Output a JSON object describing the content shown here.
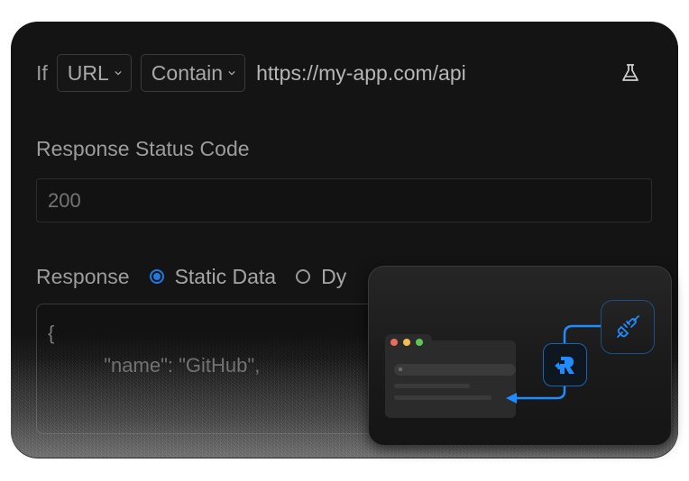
{
  "condition": {
    "if_label": "If",
    "field_select": "URL",
    "operator_select": "Contain",
    "url_value": "https://my-app.com/api",
    "test_icon": "flask-icon"
  },
  "status": {
    "label": "Response Status Code",
    "placeholder": "200"
  },
  "response": {
    "label": "Response",
    "options": [
      {
        "label": "Static Data",
        "checked": true
      },
      {
        "label": "Dy",
        "checked": false
      }
    ],
    "code_lines": [
      "{",
      "  \"name\": \"GitHub\","
    ]
  },
  "overlay_card": {
    "window_dots": [
      "#ec6a5e",
      "#f4bf4f",
      "#61c554"
    ],
    "logo_letter": "R",
    "plug_icon": "plug-icon",
    "accent": "#1f8cff"
  }
}
